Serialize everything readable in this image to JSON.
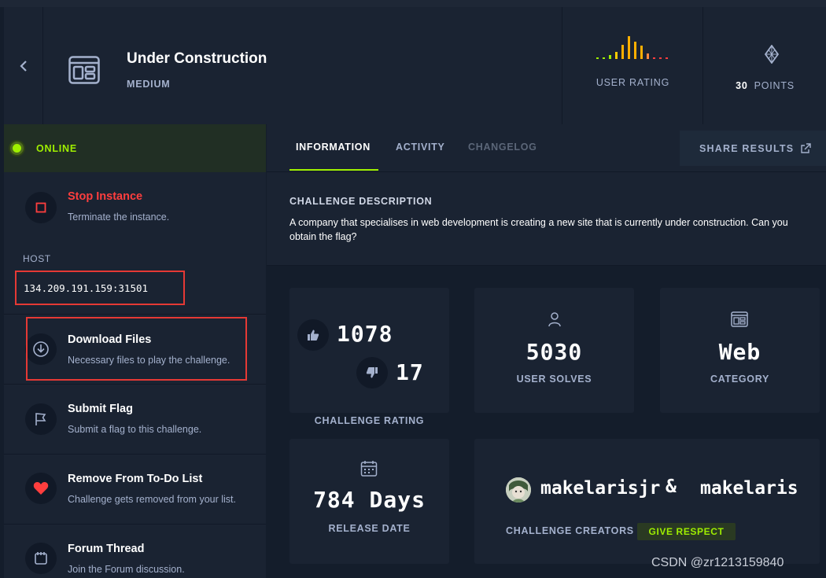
{
  "header": {
    "title": "Under Construction",
    "difficulty": "MEDIUM",
    "user_rating_label": "USER RATING",
    "points_value": "30",
    "points_label": "POINTS"
  },
  "sidebar": {
    "status": "ONLINE",
    "stop": {
      "title": "Stop Instance",
      "subtitle": "Terminate the instance."
    },
    "host_label": "HOST",
    "host_value": "134.209.191.159:31501",
    "download": {
      "title": "Download Files",
      "subtitle": "Necessary files to play the challenge."
    },
    "submit": {
      "title": "Submit Flag",
      "subtitle": "Submit a flag to this challenge."
    },
    "todo": {
      "title": "Remove From To-Do List",
      "subtitle": "Challenge gets removed from your list."
    },
    "forum": {
      "title": "Forum Thread",
      "subtitle": "Join the Forum discussion."
    }
  },
  "tabs": {
    "information": "INFORMATION",
    "activity": "ACTIVITY",
    "changelog": "CHANGELOG",
    "share": "SHARE RESULTS"
  },
  "description": {
    "title": "CHALLENGE DESCRIPTION",
    "text": "A company that specialises in web development is creating a new site that is currently under construction. Can you obtain the flag?"
  },
  "stats": {
    "likes": "1078",
    "dislikes": "17",
    "rating_label": "CHALLENGE RATING",
    "solves": "5030",
    "solves_label": "USER SOLVES",
    "category": "Web",
    "category_label": "CATEGORY",
    "release": "784 Days",
    "release_label": "RELEASE DATE"
  },
  "creators": {
    "creator_1": "makelarisjr",
    "separator": "&",
    "creator_2": "makelaris",
    "label": "CHALLENGE CREATORS",
    "respect_button": "GIVE RESPECT"
  },
  "watermark": "CSDN @zr1213159840",
  "colors": {
    "accent_green": "#9fef00",
    "danger_red": "#ff3e3e",
    "panel": "#1a2332",
    "background": "#141d2b"
  },
  "icons": [
    "back-icon",
    "machine-icon",
    "gem-icon",
    "stop-icon",
    "download-icon",
    "flag-icon",
    "heart-icon",
    "forum-icon",
    "share-icon",
    "thumbs-up-icon",
    "thumbs-down-icon",
    "user-icon",
    "category-icon",
    "calendar-icon"
  ]
}
